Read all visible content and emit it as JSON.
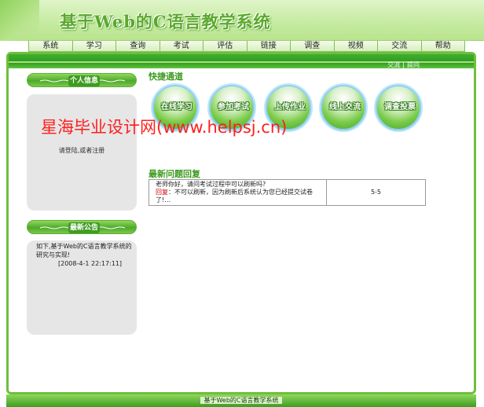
{
  "site": {
    "title": "基于Web的C语言教学系统"
  },
  "nav": [
    "系统",
    "学习",
    "查询",
    "考试",
    "评估",
    "链接",
    "调查",
    "视频",
    "交流",
    "帮助"
  ],
  "top_links": [
    "交流",
    "提问"
  ],
  "sidebar": {
    "user_title": "个人信息",
    "login_prompt": "请登陆,或者注册",
    "notice_title": "最新公告",
    "notice_text": "如下,基于Web的C语言教学系统的研究与实现!",
    "notice_date": "[2008-4-1 22:17:11]"
  },
  "quick": {
    "title": "快捷通道",
    "buttons": [
      "在线学习",
      "参加考试",
      "上传作业",
      "线上交流",
      "调查投票"
    ]
  },
  "watermark": "星海毕业设计网(www.helpsj.cn)",
  "qa": {
    "title": "最新问题回复",
    "question": "老师你好，请问考试过程中可以刷新吗?",
    "answer_label": "回复",
    "answer": "不可以刷新，因为刷新后系统认为您已经提交试卷了!…",
    "count": "5-5"
  },
  "footer": {
    "text": "基于Web的C语言教学系统"
  }
}
